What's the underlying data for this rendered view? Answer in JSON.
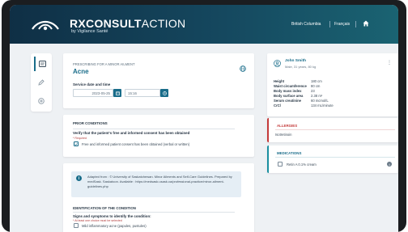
{
  "header": {
    "brand_bold": "RXCONSULT",
    "brand_thin": "ACTION",
    "tagline": "by Vigilance Santé",
    "region": "British Columbia",
    "language": "Français"
  },
  "prescribing": {
    "label": "PRESCRIBING FOR A MINOR AILMENT",
    "condition": "Acne",
    "service_label": "Service date and time",
    "date_value": "2023-05-25",
    "time_value": "15:16"
  },
  "prior_conditions": {
    "title": "PRIOR CONDITIONS",
    "question": "Verify that the patient's free and informed consent has been obtained",
    "required": "* Required",
    "option": "Free and informed patient consent has been obtained (verbal or written)"
  },
  "identification": {
    "info_text": "Adapted from : © University of Saskatchewan. Minor Ailments and Self-Care Guidelines. Prepared by medSask. Saskatoon. Available : https://medsask.usask.ca/professional-practice/minor-ailment-guidelines.php",
    "title": "IDENTIFICATION OF THE CONDITION",
    "question": "Signs and symptoms to identify the condition:",
    "required": "* At least one choice must be selected",
    "option": "Mild inflammatory acne (papules, pustules)"
  },
  "patient": {
    "name": "John Smith",
    "meta": "Male, 31 years, 80 kg",
    "stats": [
      {
        "label": "Height",
        "value": "180 cm"
      },
      {
        "label": "Waist circumference",
        "value": "80 cm"
      },
      {
        "label": "Body mass index",
        "value": "23"
      },
      {
        "label": "Body surface area",
        "value": "2.38 m²"
      },
      {
        "label": "Serum creatinine",
        "value": "60 mcmol/L"
      },
      {
        "label": "CrCl",
        "value": "134 mL/minute"
      }
    ]
  },
  "allergies": {
    "title": "ALLERGIES",
    "item": "Isotretinoin"
  },
  "medications": {
    "title": "MEDICATIONS",
    "item": "Retin A 0.1% cream"
  }
}
